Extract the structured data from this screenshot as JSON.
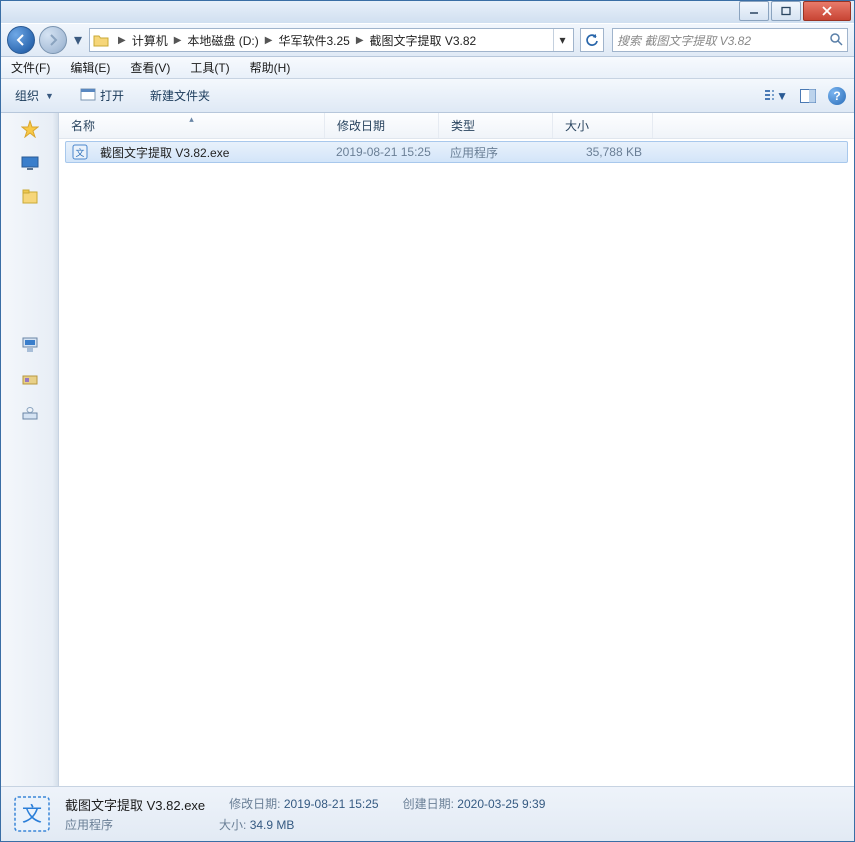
{
  "titlebar": {
    "min": "—",
    "max": "□",
    "close": "X"
  },
  "breadcrumbs": [
    "计算机",
    "本地磁盘 (D:)",
    "华军软件3.25",
    "截图文字提取 V3.82"
  ],
  "search": {
    "placeholder": "搜索 截图文字提取 V3.82"
  },
  "menubar": [
    "文件(F)",
    "编辑(E)",
    "查看(V)",
    "工具(T)",
    "帮助(H)"
  ],
  "toolbar": {
    "organize": "组织",
    "open": "打开",
    "newfolder": "新建文件夹"
  },
  "columns": {
    "name": "名称",
    "modified": "修改日期",
    "type": "类型",
    "size": "大小"
  },
  "files": [
    {
      "name": "截图文字提取 V3.82.exe",
      "modified": "2019-08-21 15:25",
      "type": "应用程序",
      "size": "35,788 KB"
    }
  ],
  "details": {
    "filename": "截图文字提取 V3.82.exe",
    "filetype": "应用程序",
    "modified_label": "修改日期:",
    "modified_value": "2019-08-21 15:25",
    "created_label": "创建日期:",
    "created_value": "2020-03-25 9:39",
    "size_label": "大小:",
    "size_value": "34.9 MB"
  }
}
